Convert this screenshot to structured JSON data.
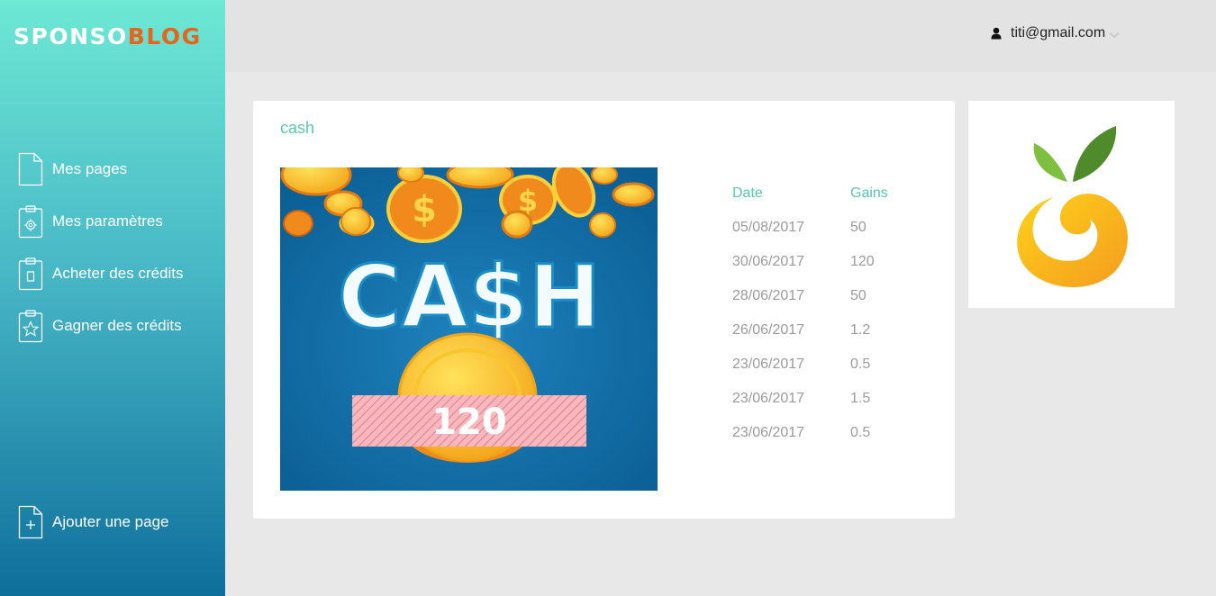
{
  "brand": {
    "part1": "SPONSO",
    "part2": "BLOG",
    "colors": {
      "part1": "#ffffff",
      "part2": "#e8641a"
    }
  },
  "sidebar": {
    "items": [
      {
        "label": "Mes pages",
        "icon": "document-icon"
      },
      {
        "label": "Mes paramètres",
        "icon": "clipboard-gear-icon"
      },
      {
        "label": "Acheter des crédits",
        "icon": "clipboard-card-icon"
      },
      {
        "label": "Gagner des crédits",
        "icon": "clipboard-star-icon"
      }
    ],
    "add_page": {
      "label": "Ajouter une page",
      "icon": "document-plus-icon"
    }
  },
  "header": {
    "user_email": "titi@gmail.com",
    "user_icon": "user-icon",
    "dropdown_icon": "chevron-down-icon"
  },
  "card": {
    "title": "cash",
    "image": {
      "heading": "CA$H",
      "amount": "120"
    },
    "table": {
      "columns": [
        "Date",
        "Gains"
      ],
      "rows": [
        [
          "05/08/2017",
          "50"
        ],
        [
          "30/06/2017",
          "120"
        ],
        [
          "28/06/2017",
          "50"
        ],
        [
          "26/06/2017",
          "1.2"
        ],
        [
          "23/06/2017",
          "0.5"
        ],
        [
          "23/06/2017",
          "1.5"
        ],
        [
          "23/06/2017",
          "0.5"
        ]
      ]
    }
  },
  "colors": {
    "accent": "#57c8b0",
    "muted_text": "#9b9b9b",
    "sidebar_top": "#6de8d4",
    "sidebar_bottom": "#0f6f9c"
  }
}
